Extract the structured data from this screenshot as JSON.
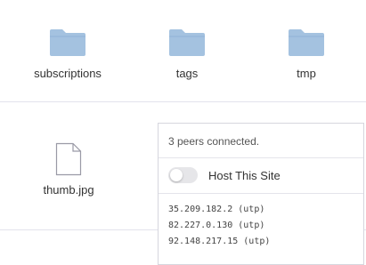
{
  "folders": [
    {
      "name": "subscriptions",
      "icon": "folder-icon"
    },
    {
      "name": "tags",
      "icon": "folder-icon"
    },
    {
      "name": "tmp",
      "icon": "folder-icon"
    }
  ],
  "files": [
    {
      "name": "thumb.jpg",
      "icon": "file-icon"
    }
  ],
  "peers_panel": {
    "status": "3 peers connected.",
    "host_toggle": {
      "label": "Host This Site",
      "enabled": false
    },
    "peers": [
      "35.209.182.2 (utp)",
      "82.227.0.130 (utp)",
      "92.148.217.15 (utp)"
    ]
  },
  "colors": {
    "folder": "#a4c2e0",
    "folder_tab": "#8fb3d9",
    "divider": "#e3e3ec",
    "toggle_off": "#e6e6e9"
  }
}
